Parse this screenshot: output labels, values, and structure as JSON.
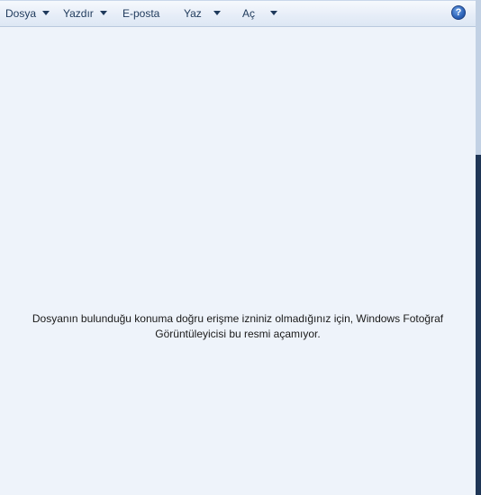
{
  "menubar": {
    "items": [
      {
        "label": "Dosya",
        "has_dropdown": true
      },
      {
        "label": "Yazdır",
        "has_dropdown": true
      },
      {
        "label": "E-posta",
        "has_dropdown": false
      },
      {
        "label": "Yaz",
        "has_dropdown": true
      },
      {
        "label": "Aç",
        "has_dropdown": true
      }
    ],
    "help_icon": "help-icon",
    "help_glyph": "?"
  },
  "content": {
    "message_line1": "Dosyanın bulunduğu konuma doğru erişme izniniz olmadığınız için, Windows Fotoğraf",
    "message_line2": "Görüntüleyicisi bu resmi açamıyor."
  },
  "colors": {
    "background": "#eef3fa",
    "menu_text": "#1e395b",
    "help_blue": "#2d63b8"
  }
}
